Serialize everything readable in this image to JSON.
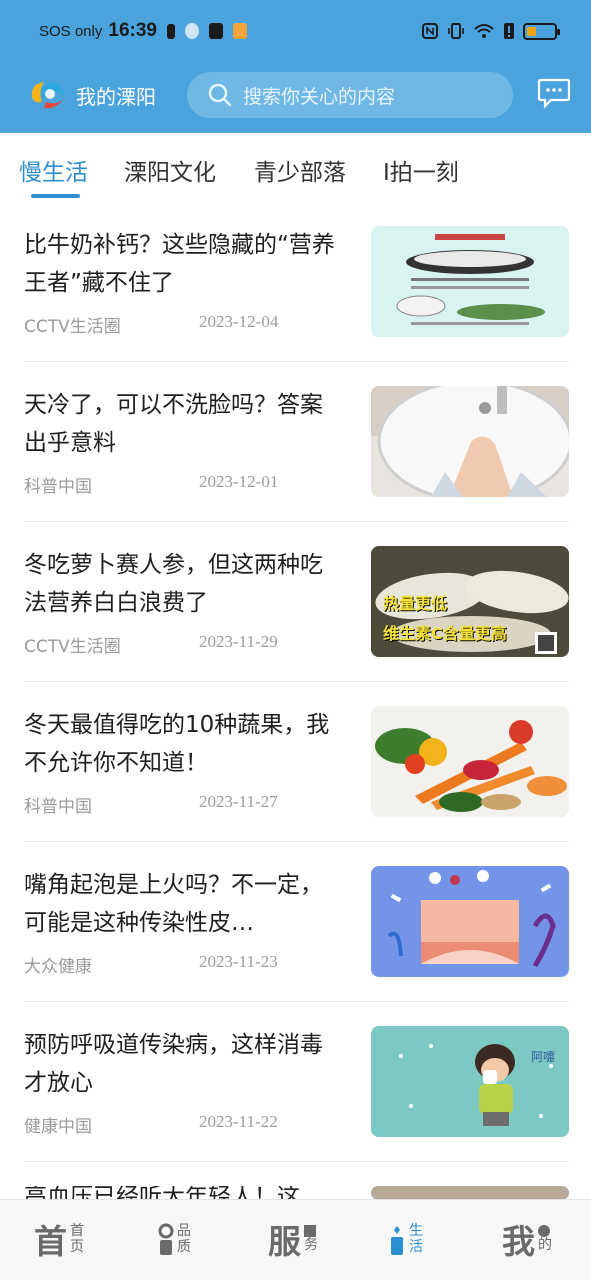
{
  "status_bar": {
    "carrier": "SOS only",
    "time": "16:39",
    "battery_level": 0.35,
    "battery_color": "#f2a316"
  },
  "header": {
    "app_name": "我的溧阳",
    "search_placeholder": "搜索你关心的内容",
    "icons": [
      "app-logo-icon",
      "search-icon",
      "message-icon"
    ],
    "bg_color": "#4aa3dd"
  },
  "tabs": [
    {
      "label": "慢生活",
      "active": true
    },
    {
      "label": "溧阳文化",
      "active": false
    },
    {
      "label": "青少部落",
      "active": false
    },
    {
      "label": "I拍一刻",
      "active": false
    }
  ],
  "articles": [
    {
      "title": "比牛奶补钙？这些隐藏的“营养王者”藏不住了",
      "source": "CCTV生活圈",
      "date": "2023-12-04",
      "image": "nutrition-infographic"
    },
    {
      "title": "天冷了，可以不洗脸吗？答案出乎意料",
      "source": "科普中国",
      "date": "2023-12-01",
      "image": "hand-washing-sink"
    },
    {
      "title": "冬吃萝卜赛人参，但这两种吃法营养白白浪费了",
      "source": "CCTV生活圈",
      "date": "2023-11-29",
      "image": "radish-tv-screenshot",
      "image_caption_1": "热量更低",
      "image_caption_2": "维生素C含量更高"
    },
    {
      "title": "冬天最值得吃的10种蔬果，我不允许你不知道！",
      "source": "科普中国",
      "date": "2023-11-27",
      "image": "vegetables-fruits"
    },
    {
      "title": "嘴角起泡是上火吗？不一定，可能是这种传染性皮…",
      "source": "大众健康",
      "date": "2023-11-23",
      "image": "skin-illustration"
    },
    {
      "title": "预防呼吸道传染病，这样消毒才放心",
      "source": "健康中国",
      "date": "2023-11-22",
      "image": "sneezing-child-illustration",
      "image_caption_1": "阿嚏"
    }
  ],
  "partial_item": {
    "title": "高血压已经听大年轻人！这"
  },
  "bottom_nav": [
    {
      "big": "首",
      "small_1": "首",
      "small_2": "页",
      "icon": "home-icon",
      "active": false
    },
    {
      "big": "品",
      "small_1": "品",
      "small_2": "质",
      "icon": "quality-icon",
      "active": false
    },
    {
      "big": "服",
      "small_1": "服",
      "small_2": "务",
      "icon": "service-icon",
      "active": false
    },
    {
      "big": "生",
      "small_1": "生",
      "small_2": "活",
      "icon": "life-icon",
      "active": true
    },
    {
      "big": "我",
      "small_1": "我",
      "small_2": "的",
      "icon": "profile-icon",
      "active": false
    }
  ]
}
